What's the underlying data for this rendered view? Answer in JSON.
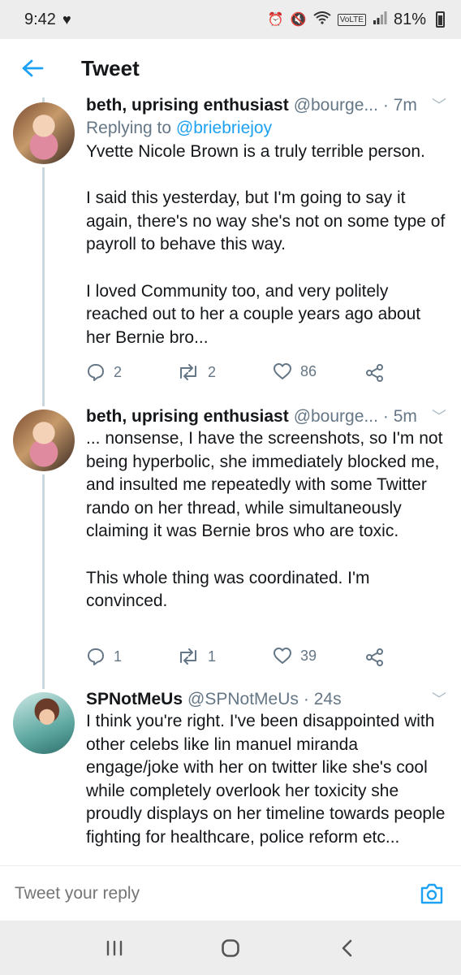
{
  "status_bar": {
    "time": "9:42",
    "battery": "81%"
  },
  "header": {
    "title": "Tweet"
  },
  "tweets": [
    {
      "name": "beth, uprising enthusiast",
      "handle": "@bourge...",
      "time": "· 7m",
      "replying_prefix": "Replying to ",
      "replying_to": "@briebriejoy",
      "text": "Yvette Nicole Brown is a truly terrible person.\n\nI said this yesterday, but I'm going to say it again, there's no way she's not on some type of payroll to behave this way.\n\nI loved Community too, and very politely reached out to her a couple years ago about her Bernie bro...",
      "replies": "2",
      "retweets": "2",
      "likes": "86"
    },
    {
      "name": "beth, uprising enthusiast",
      "handle": "@bourge...",
      "time": "· 5m",
      "text": "... nonsense, I have the screenshots, so I'm not being hyperbolic, she immediately blocked me, and insulted me repeatedly with some Twitter rando on her thread, while simultaneously claiming it was Bernie bros who are toxic.\n\nThis whole thing was coordinated. I'm convinced.",
      "replies": "1",
      "retweets": "1",
      "likes": "39"
    },
    {
      "name": "SPNotMeUs",
      "handle": "@SPNotMeUs",
      "time": "· 24s",
      "text": "I think you're right. I've been disappointed with other celebs like lin manuel miranda engage/joke with her on twitter like she's cool while completely overlook her toxicity she proudly displays on her timeline towards people fighting for healthcare, police reform etc..."
    }
  ],
  "reply_bar": {
    "placeholder": "Tweet your reply"
  },
  "colors": {
    "accent": "#1da1f2",
    "text": "#14171a",
    "muted": "#657786",
    "thread_line": "#ccd6dd"
  },
  "icons": {
    "back": "arrow-left-icon",
    "reply": "speech-bubble-icon",
    "retweet": "retweet-icon",
    "like": "heart-icon",
    "share": "share-nodes-icon",
    "camera": "camera-icon",
    "recents": "recent-apps-icon",
    "home": "home-icon",
    "nav_back": "chevron-left-icon"
  }
}
